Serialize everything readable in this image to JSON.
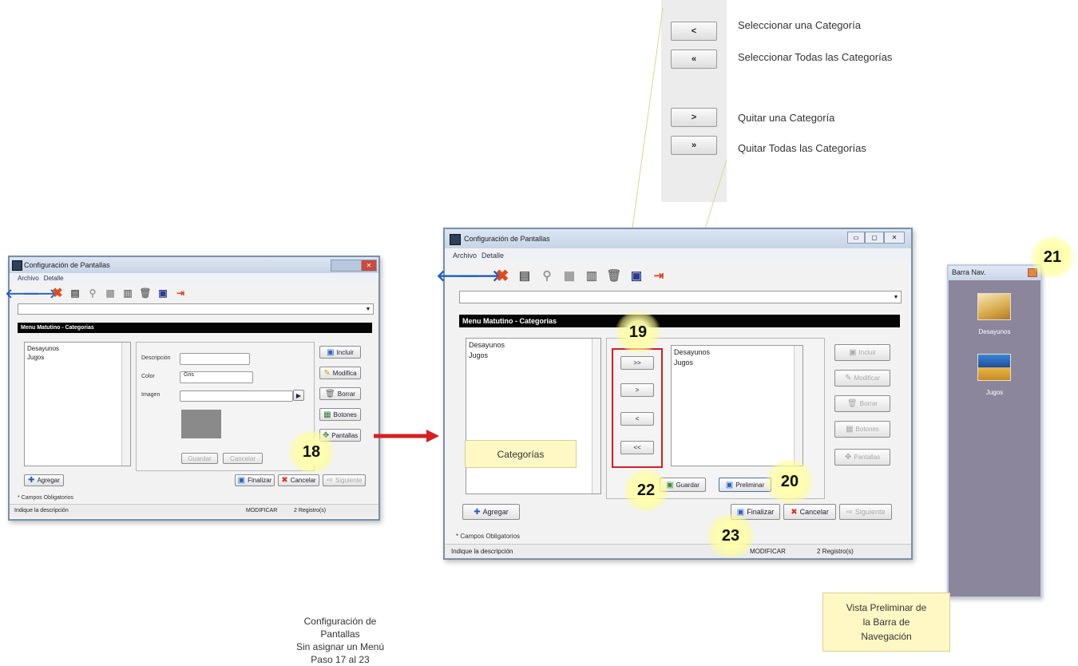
{
  "legend": {
    "items": [
      {
        "symbol": "<",
        "text": "Seleccionar una Categoría"
      },
      {
        "symbol": "«",
        "text": "Seleccionar Todas las Categorías"
      },
      {
        "symbol": ">",
        "text": "Quitar una Categoría"
      },
      {
        "symbol": "»",
        "text": "Quitar Todas las Categorías"
      }
    ]
  },
  "left_window": {
    "title": "Configuración de Pantallas",
    "menu": [
      "Archivo",
      "Detalle"
    ],
    "section_title": "Menu Matutino - Categorias",
    "list_items": [
      "Desayunos",
      "Jugos"
    ],
    "labels": {
      "descripcion": "Descripción",
      "color": "Color",
      "imagen": "Imagen"
    },
    "color_value": "Gris",
    "side_buttons": [
      "Incluir",
      "Modifica",
      "Borrar",
      "Botones",
      "Pantallas"
    ],
    "bottom_buttons": {
      "guardar": "Guardar",
      "cancelar": "Cancelar"
    },
    "agregar": "Agregar",
    "footer_buttons": [
      "Finalizar",
      "Cancelar",
      "Siguiente"
    ],
    "required_note": "* Campos Obligatorios",
    "status": {
      "hint": "Indique la descripción",
      "mode": "MODIFICAR",
      "records": "2 Registro(s)"
    }
  },
  "right_window": {
    "title": "Configuración de Pantallas",
    "menu": [
      "Archivo",
      "Detalle"
    ],
    "section_title": "Menu Matutino - Categorias",
    "available_items": [
      "Desayunos",
      "Jugos"
    ],
    "selected_items": [
      "Desayunos",
      "Jugos"
    ],
    "move_buttons": [
      ">>",
      ">",
      "<",
      "<<"
    ],
    "side_buttons": [
      "Incluir",
      "Modificar",
      "Borrar",
      "Botones",
      "Pantallas"
    ],
    "guardar": "Guardar",
    "preliminar": "Preliminar",
    "agregar": "Agregar",
    "footer_buttons": [
      "Finalizar",
      "Cancelar",
      "Siguiente"
    ],
    "required_note": "* Campos Obligatorios",
    "status": {
      "hint": "Indique la descripción",
      "mode": "MODIFICAR",
      "records": "2 Registro(s)"
    }
  },
  "nav_bar": {
    "title": "Barra Nav.",
    "items": [
      "Desayunos",
      "Jugos"
    ]
  },
  "badges": [
    "18",
    "19",
    "20",
    "21",
    "22",
    "23"
  ],
  "callouts": {
    "categorias": "Categorías",
    "vista_lines": [
      "Vista Preliminar de",
      "la Barra de",
      "Navegación"
    ]
  },
  "caption": [
    "Configuración de Pantallas",
    "Sin asignar un Menú",
    "Paso 17 al 23"
  ],
  "colors": {
    "highlight_red": "#d42020",
    "nav_bg": "#8b869b",
    "callout_bg": "#fff8c4"
  }
}
